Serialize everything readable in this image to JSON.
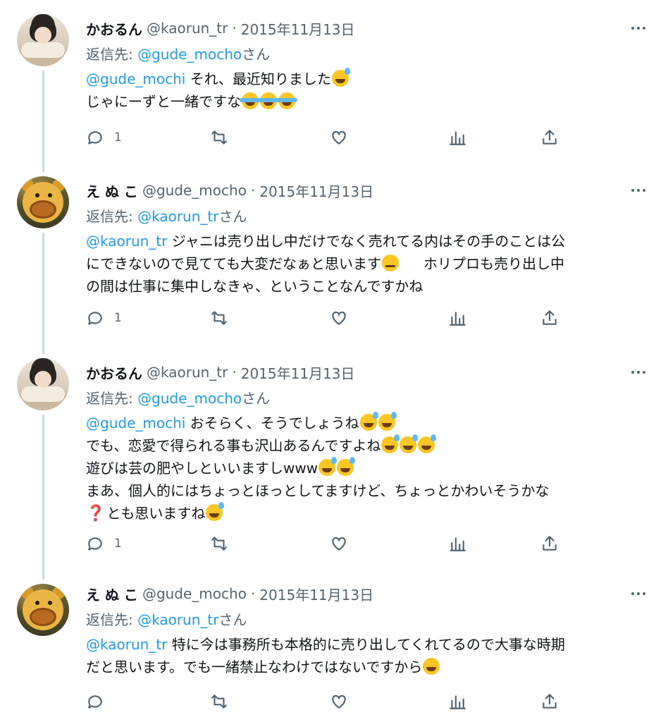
{
  "tweets": [
    {
      "name": "かおるん",
      "handle": "@kaorun_tr",
      "separator": "·",
      "date": "2015年11月13日",
      "reply_label_prefix": "返信先: ",
      "reply_to": "@gude_mocho",
      "reply_label_suffix": "さん",
      "lines": [
        {
          "mention": "@gude_mochi",
          "text": " それ、最近知りました"
        },
        {
          "mention": "",
          "text": "じゃにーずと一緒ですな"
        }
      ],
      "reply_count": "1",
      "avatar": "kaorun-avatar"
    },
    {
      "name": "え ぬ こ",
      "handle": "@gude_mocho",
      "separator": "·",
      "date": "2015年11月13日",
      "reply_label_prefix": "返信先: ",
      "reply_to": "@kaorun_tr",
      "reply_label_suffix": "さん",
      "lines": [
        {
          "mention": "@kaorun_tr",
          "text": " ジャニは売り出し中だけでなく売れてる内はその手のことは公"
        },
        {
          "mention": "",
          "text": "にできないので見てても大変だなぁと思います"
        },
        {
          "mention": "",
          "text": "ホリプロも売り出し中"
        },
        {
          "mention": "",
          "text": "の間は仕事に集中しなきゃ、ということなんですかね"
        }
      ],
      "reply_count": "1",
      "avatar": "enuko-avatar"
    },
    {
      "name": "かおるん",
      "handle": "@kaorun_tr",
      "separator": "·",
      "date": "2015年11月13日",
      "reply_label_prefix": "返信先: ",
      "reply_to": "@gude_mocho",
      "reply_label_suffix": "さん",
      "lines": [
        {
          "mention": "@gude_mochi",
          "text": " おそらく、そうでしょうね"
        },
        {
          "mention": "",
          "text": "でも、恋愛で得られる事も沢山あるんですよね"
        },
        {
          "mention": "",
          "text": "遊びは芸の肥やしといいますしwww"
        },
        {
          "mention": "",
          "text": "まあ、個人的にはちょっとほっとしてますけど、ちょっとかわいそうかな"
        },
        {
          "mention": "",
          "text": "とも思いますね"
        }
      ],
      "reply_count": "1",
      "avatar": "kaorun-avatar"
    },
    {
      "name": "え ぬ こ",
      "handle": "@gude_mocho",
      "separator": "·",
      "date": "2015年11月13日",
      "reply_label_prefix": "返信先: ",
      "reply_to": "@kaorun_tr",
      "reply_label_suffix": "さん",
      "lines": [
        {
          "mention": "@kaorun_tr",
          "text": " 特に今は事務所も本格的に売り出してくれてるので大事な時期"
        },
        {
          "mention": "",
          "text": "だと思います。でも一緒禁止なわけではないですから"
        }
      ],
      "reply_count": "",
      "avatar": "enuko-avatar"
    }
  ],
  "question_mark": "❓",
  "colors": {
    "text": "#0f1419",
    "secondary": "#536471",
    "link": "#1d9bf0",
    "thread_line": "#cfd9de"
  },
  "icons": [
    "reply-icon",
    "retweet-icon",
    "like-icon",
    "views-icon",
    "share-icon",
    "more-icon"
  ]
}
